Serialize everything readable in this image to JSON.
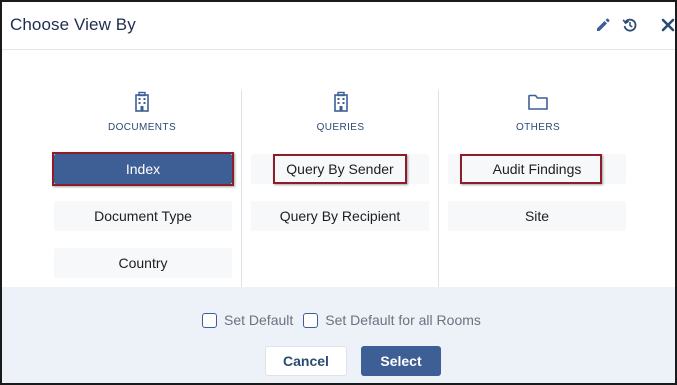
{
  "dialog": {
    "title": "Choose View By",
    "icons": [
      "pencil-icon",
      "reset-icon",
      "close-icon"
    ]
  },
  "columns": {
    "documents": {
      "heading": "DOCUMENTS",
      "icon": "building-icon",
      "options": [
        "Index",
        "Document Type",
        "Country"
      ]
    },
    "queries": {
      "heading": "QUERIES",
      "icon": "building-icon",
      "options": [
        "Query By Sender",
        "Query By Recipient"
      ]
    },
    "others": {
      "heading": "OTHERS",
      "icon": "folder-icon",
      "options": [
        "Audit Findings",
        "Site"
      ]
    }
  },
  "selected_option": "Index",
  "footer": {
    "set_default_label": "Set Default",
    "set_default_all_label": "Set Default for all Rooms",
    "set_default_checked": false,
    "set_default_all_checked": false,
    "cancel_label": "Cancel",
    "select_label": "Select"
  },
  "colors": {
    "primary": "#3d5f95",
    "title": "#1f2d4e",
    "highlight_border": "#8b1e2a",
    "footer_bg": "#edf2f8"
  }
}
